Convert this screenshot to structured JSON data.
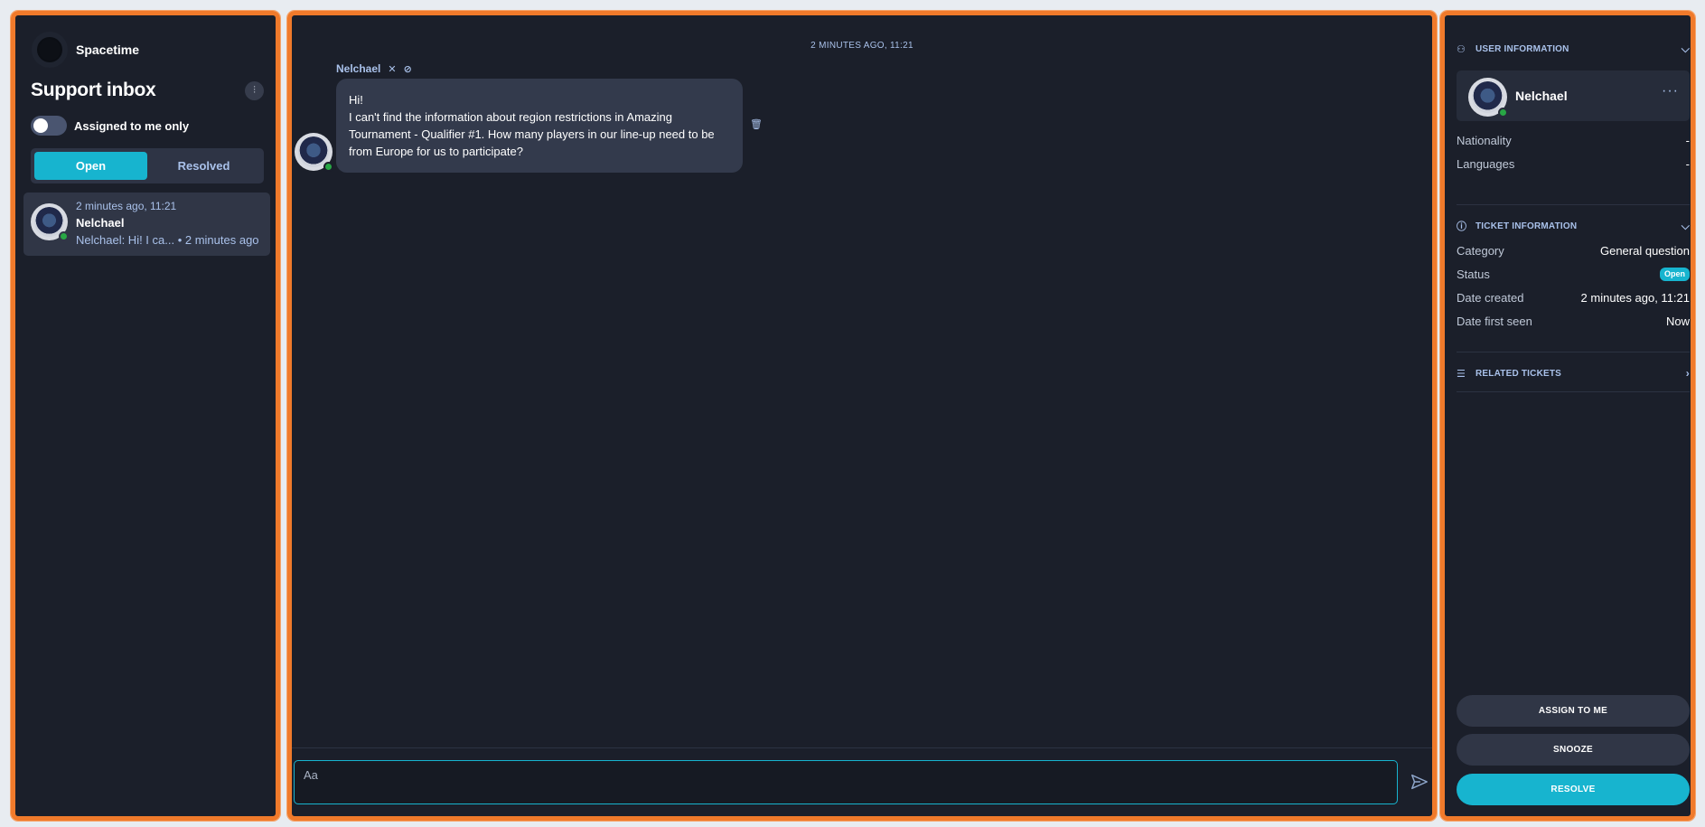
{
  "sidebar": {
    "brand": "Spacetime",
    "title": "Support inbox",
    "filter_icon": "sliders-icon",
    "toggle_label": "Assigned to me only",
    "tabs": [
      {
        "label": "Open",
        "active": true
      },
      {
        "label": "Resolved",
        "active": false
      }
    ],
    "conversation": {
      "time": "2 minutes ago, 11:21",
      "name": "Nelchael",
      "preview": "Nelchael: Hi! I ca... • 2 minutes ago"
    }
  },
  "chat": {
    "day_separator": "2 MINUTES AGO, 11:21",
    "author": "Nelchael",
    "message_lines": [
      "Hi!",
      "I can't find the information about region restrictions in Amazing",
      "Tournament - Qualifier #1. How many players in our line-up need to be",
      "from Europe for us to participate?"
    ],
    "composer_placeholder": "Aa"
  },
  "details": {
    "user_section": "USER INFORMATION",
    "user_name": "Nelchael",
    "user_more": "···",
    "nationality_label": "Nationality",
    "nationality_value": "-",
    "languages_label": "Languages",
    "languages_value": "-",
    "ticket_section": "TICKET INFORMATION",
    "category_label": "Category",
    "category_value": "General question",
    "status_label": "Status",
    "status_value": "Open",
    "created_label": "Date created",
    "created_value": "2 minutes ago, 11:21",
    "first_seen_label": "Date first seen",
    "first_seen_value": "Now",
    "related_section": "RELATED TICKETS",
    "buttons": {
      "assign": "ASSIGN TO ME",
      "snooze": "SNOOZE",
      "resolve": "RESOLVE"
    }
  },
  "colors": {
    "accent": "#17b4cf",
    "panel_border": "#f07a2b",
    "panel_bg": "#1b1f2a",
    "online": "#28a745"
  }
}
